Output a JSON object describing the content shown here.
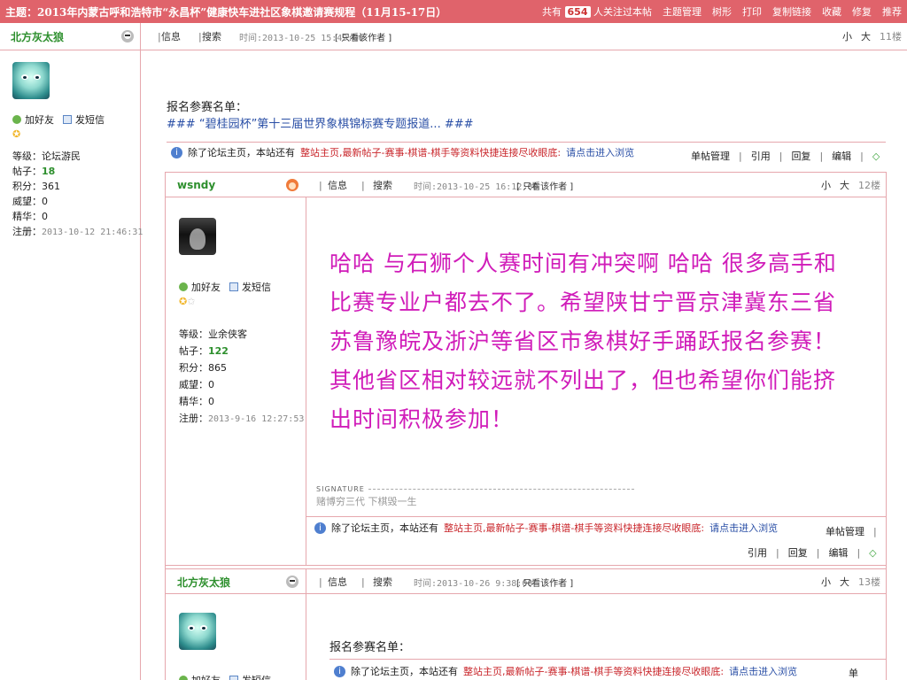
{
  "topbar": {
    "title": "主题：2013年内蒙古呼和浩特市“永昌杯”健康快车进社区象棋邀请赛规程（11月15-17日）",
    "followers_prefix": "共有",
    "followers_count": "654",
    "followers_suffix": "人关注过本帖",
    "links": [
      "主题管理",
      "树形",
      "打印",
      "复制链接",
      "收藏",
      "修复",
      "推荐"
    ]
  },
  "post11": {
    "author": "北方灰太狼",
    "info": "信息",
    "search": "搜索",
    "time": "时间:2013-10-25 15:49:00",
    "only_author": "[ 只看该作者 ]",
    "size_small": "小",
    "size_big": "大",
    "floor": "11楼",
    "user": {
      "add_friend": "加好友",
      "send_message": "发短信",
      "level_label": "等级：",
      "level": "论坛游民",
      "posts_label": "帖子：",
      "posts": "18",
      "points_label": "积分：",
      "points": "361",
      "prestige_label": "威望：",
      "prestige": "0",
      "essence_label": "精华：",
      "essence": "0",
      "reg_label": "注册：",
      "reg": "2013-10-12 21:46:31"
    },
    "content": {
      "line1": "报名参赛名单：",
      "line2_prefix": "###",
      "line2_link": "“碧桂园杯”第十三届世界象棋锦标赛专题报道...",
      "line2_suffix": "###"
    }
  },
  "notice": {
    "prefix": "除了论坛主页，本站还有",
    "red": "整站主页,最新帖子-赛事-棋谱-棋手等资料快捷连接尽收眼底:",
    "blue": "请点击进入浏览"
  },
  "toolbar_labels": {
    "manage": "单帖管理",
    "quote": "引用",
    "reply": "回复",
    "edit": "编辑"
  },
  "post12": {
    "author": "wsndy",
    "info": "信息",
    "search": "搜索",
    "time": "时间:2013-10-25 16:12:00",
    "only_author": "[ 只看该作者 ]",
    "size_small": "小",
    "size_big": "大",
    "floor": "12楼",
    "user": {
      "add_friend": "加好友",
      "send_message": "发短信",
      "level_label": "等级：",
      "level": "业余侠客",
      "posts_label": "帖子：",
      "posts": "122",
      "points_label": "积分：",
      "points": "865",
      "prestige_label": "威望：",
      "prestige": "0",
      "essence_label": "精华：",
      "essence": "0",
      "reg_label": "注册：",
      "reg": "2013-9-16 12:27:53"
    },
    "content_lines": [
      "哈哈 与石狮个人赛时间有冲突啊 哈哈 很多高手和",
      "比赛专业户都去不了。希望陕甘宁晋京津冀东三省",
      "苏鲁豫皖及浙沪等省区市象棋好手踊跃报名参赛！",
      "其他省区相对较远就不列出了，但也希望你们能挤",
      "出时间积极参加！"
    ],
    "signature_label": "SIGNATURE",
    "signature_text": "赌博穷三代 下棋毁一生"
  },
  "post13": {
    "author": "北方灰太狼",
    "info": "信息",
    "search": "搜索",
    "time": "时间:2013-10-26 9:38:00",
    "only_author": "[ 只看该作者 ]",
    "size_small": "小",
    "size_big": "大",
    "floor": "13楼",
    "user": {
      "add_friend": "加好友",
      "send_message": "发短信"
    },
    "content": {
      "line1": "报名参赛名单："
    },
    "manage_partial": "单"
  },
  "colors": {
    "topbar": "#e0636b",
    "border": "#e6a7ad",
    "handwriting": "#d01cb9",
    "author_green": "#2d8f2d"
  }
}
